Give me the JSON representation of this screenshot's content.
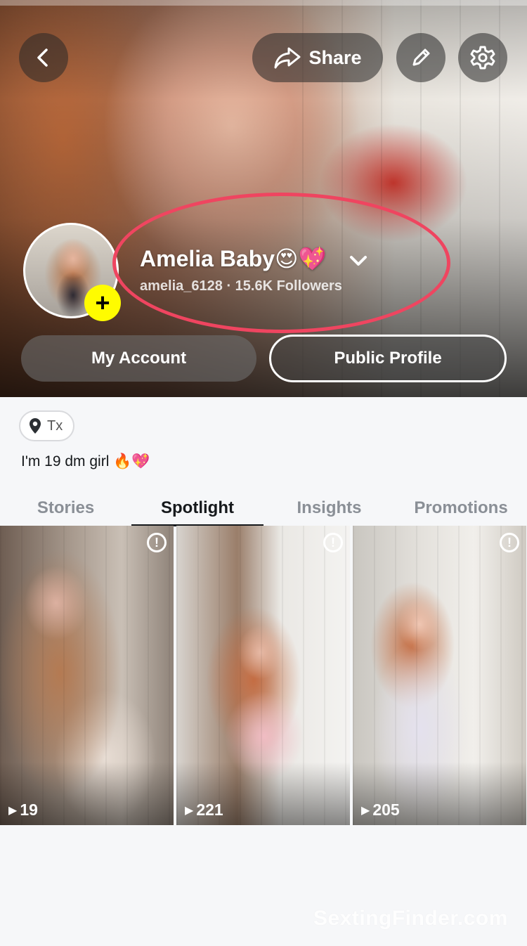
{
  "header": {
    "share_label": "Share",
    "icons": [
      "back-icon",
      "share-icon",
      "pencil-icon",
      "gear-icon"
    ]
  },
  "profile": {
    "name": "Amelia Baby😍💖",
    "subtitle": "amelia_6128 · 15.6K Followers",
    "avatar_plus": "+"
  },
  "buttons": {
    "my_account": "My Account",
    "public_profile": "Public Profile"
  },
  "info": {
    "location": "Tx",
    "bio": "I'm 19 dm girl 🔥💖"
  },
  "tabs": [
    {
      "label": "Stories",
      "active": false
    },
    {
      "label": "Spotlight",
      "active": true
    },
    {
      "label": "Insights",
      "active": false
    },
    {
      "label": "Promotions",
      "active": false
    }
  ],
  "grid": [
    {
      "views": "19",
      "alert": "!"
    },
    {
      "views": "221",
      "alert": "!"
    },
    {
      "views": "205",
      "alert": "!"
    }
  ],
  "watermark": "SextingFinder.com",
  "colors": {
    "highlight_ring": "#ef4560",
    "add_badge": "#fffc00",
    "background": "#f6f7f9"
  }
}
